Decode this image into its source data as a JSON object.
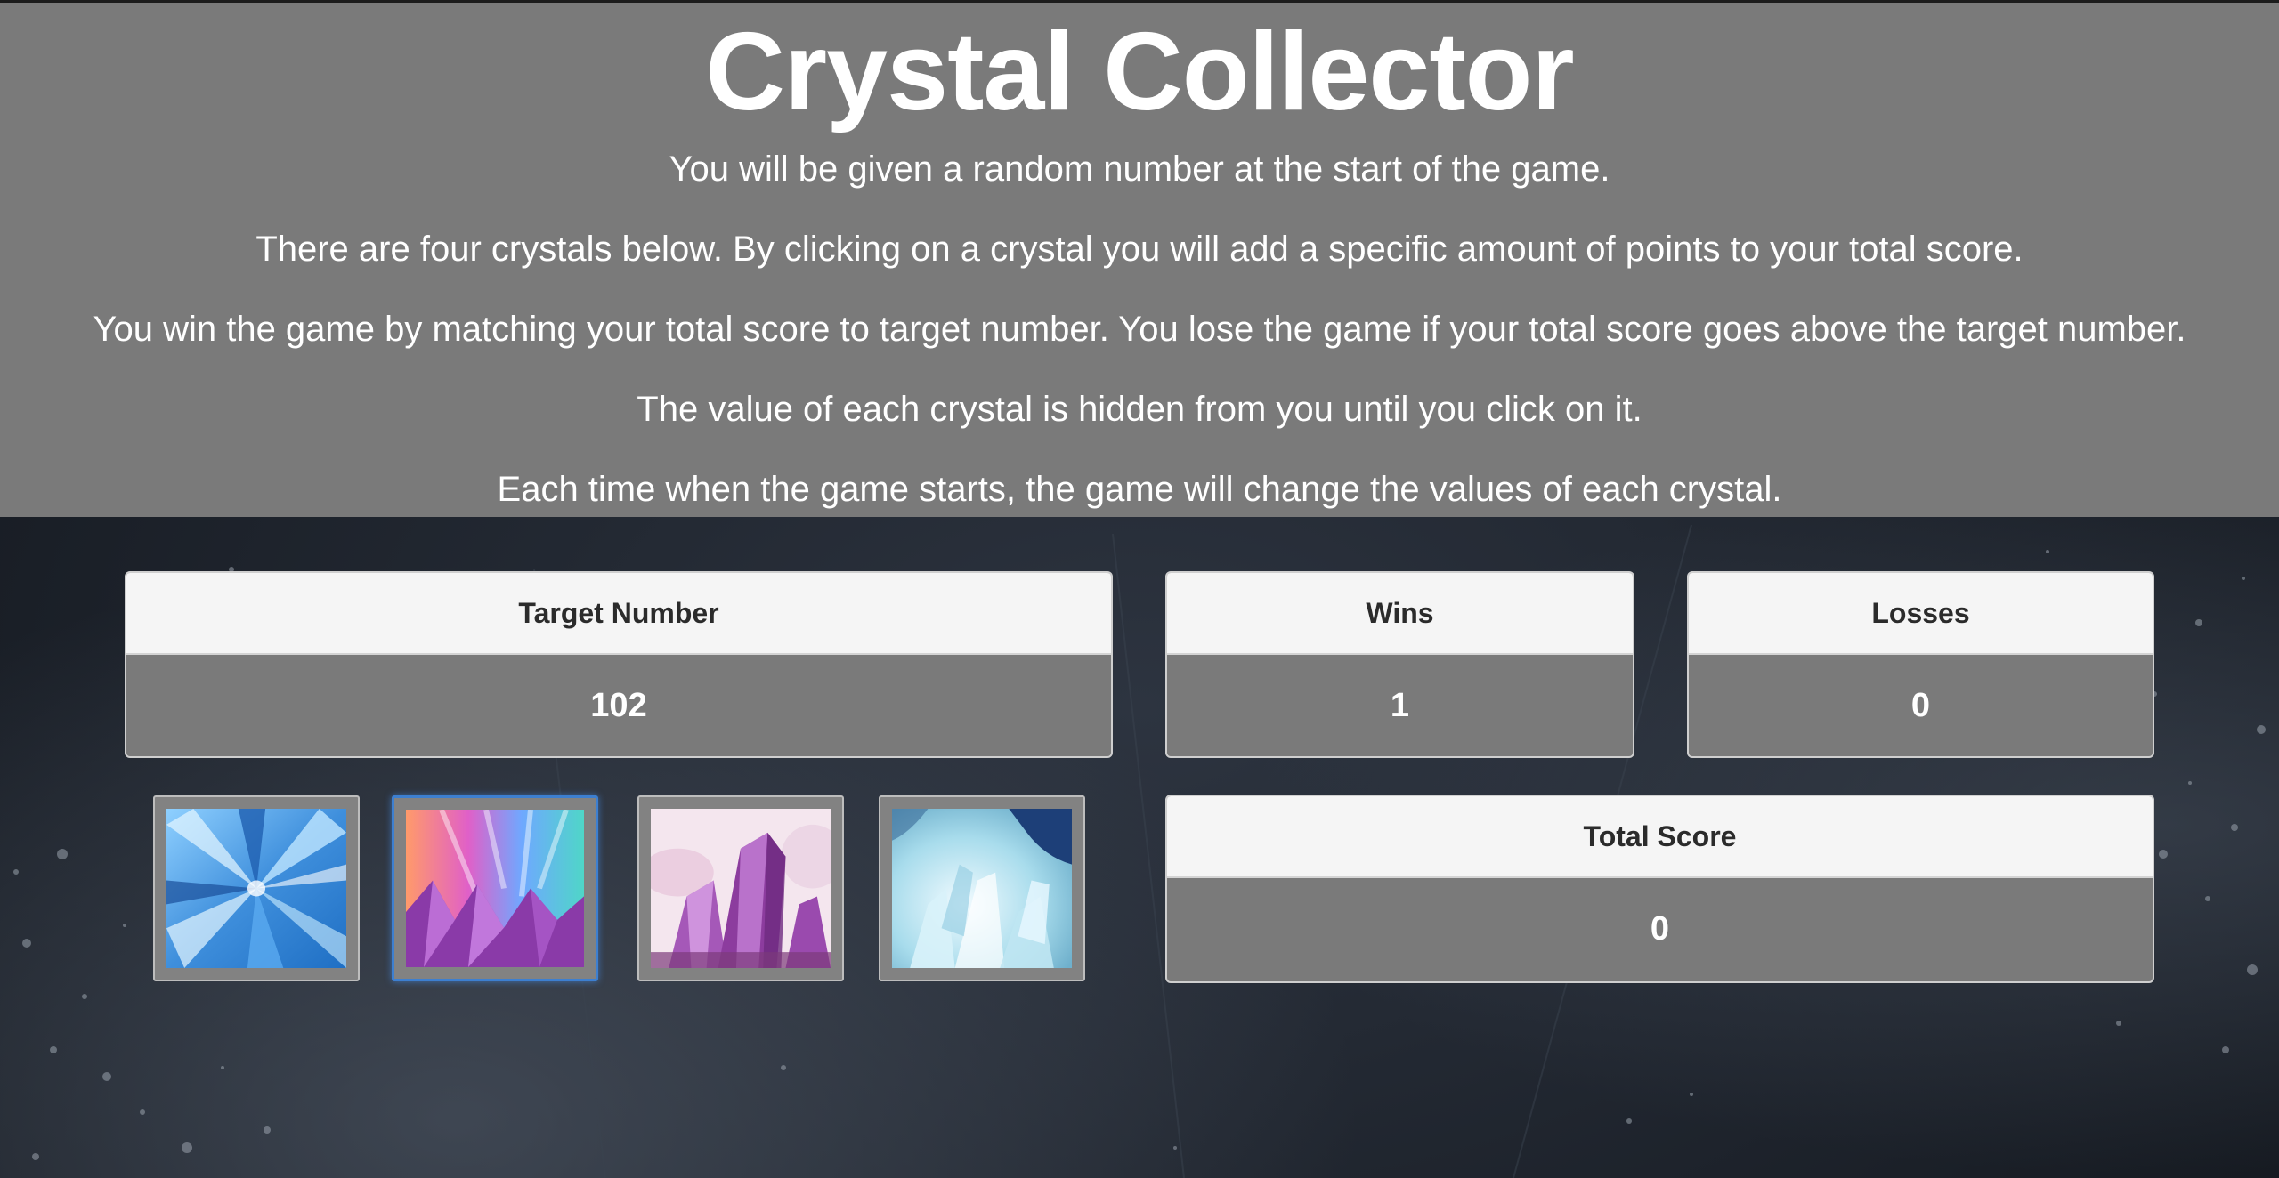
{
  "game": {
    "title": "Crystal Collector",
    "instructions": [
      "You will be given a random number at the start of the game.",
      "There are four crystals below. By clicking on a crystal you will add a specific amount of points to your total score.",
      "You win the game by matching your total score to target number. You lose the game if your total score goes above the target number.",
      "The value of each crystal is hidden from you until you click on it.",
      "Each time when the game starts, the game will change the values of each crystal."
    ]
  },
  "scoreboard": {
    "target": {
      "label": "Target Number",
      "value": "102"
    },
    "wins": {
      "label": "Wins",
      "value": "1"
    },
    "losses": {
      "label": "Losses",
      "value": "0"
    },
    "total": {
      "label": "Total Score",
      "value": "0"
    }
  },
  "crystals": [
    {
      "name": "blue-shard-crystal-icon",
      "colors": [
        "#1f6fc4",
        "#8fd0ff",
        "#e6f6ff"
      ]
    },
    {
      "name": "rainbow-amethyst-crystal-icon",
      "colors": [
        "#8a3aa8",
        "#e6a0ff",
        "#4fd6c8"
      ]
    },
    {
      "name": "amethyst-point-crystal-icon",
      "colors": [
        "#8c3c9e",
        "#d9a3e6",
        "#f4e6ee"
      ]
    },
    {
      "name": "ice-quartz-crystal-icon",
      "colors": [
        "#1d3f78",
        "#a8dcec",
        "#f2fbff"
      ]
    }
  ],
  "theme": {
    "header_bg": "#7a7a7a",
    "panel_head_bg": "#f5f5f5",
    "panel_body_bg": "#7a7a7a",
    "active_border": "#3d7fd0"
  }
}
